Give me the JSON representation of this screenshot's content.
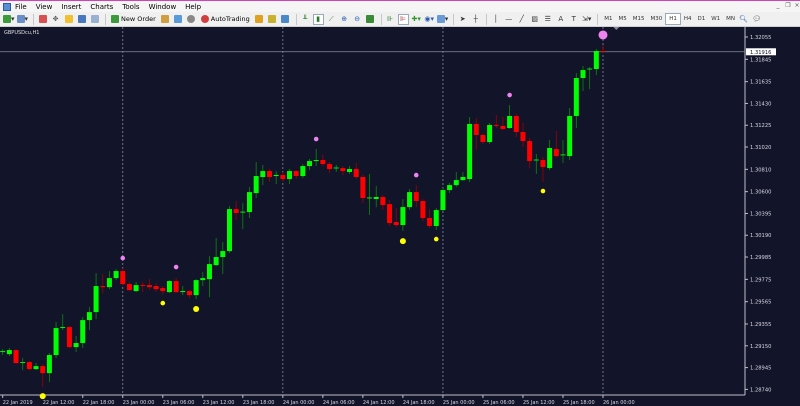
{
  "menu": {
    "items": [
      "File",
      "View",
      "Insert",
      "Charts",
      "Tools",
      "Window",
      "Help"
    ]
  },
  "window_controls": [
    "minimize",
    "restore",
    "close"
  ],
  "toolbar": {
    "new_order_label": "New Order",
    "autotrading_label": "AutoTrading",
    "timeframes": [
      "M1",
      "M5",
      "M15",
      "M30",
      "H1",
      "H4",
      "D1",
      "W1",
      "MN"
    ],
    "active_timeframe": "H1"
  },
  "chart": {
    "title": "GBPUSDcu,H1",
    "current_price": "1.31916",
    "colors": {
      "background": "#12142a",
      "bull": "#00ff00",
      "bear": "#ff0000",
      "grid": "#8a8a9a",
      "pink_marker": "#ee82ee",
      "yellow_marker": "#ffff00"
    }
  },
  "chart_data": {
    "type": "candlestick",
    "symbol": "GBPUSDcu",
    "timeframe": "H1",
    "price_ticks": [
      "1.32055",
      "1.31845",
      "1.31635",
      "1.31430",
      "1.31225",
      "1.31020",
      "1.30810",
      "1.30600",
      "1.30395",
      "1.30190",
      "1.29985",
      "1.29775",
      "1.29565",
      "1.29355",
      "1.29150",
      "1.28945",
      "1.28740",
      "1.28530"
    ],
    "time_ticks": [
      "22 Jan 2019",
      "22 Jan 12:00",
      "22 Jan 18:00",
      "23 Jan 00:00",
      "23 Jan 06:00",
      "23 Jan 12:00",
      "23 Jan 18:00",
      "24 Jan 00:00",
      "24 Jan 06:00",
      "24 Jan 12:00",
      "24 Jan 18:00",
      "25 Jan 00:00",
      "25 Jan 06:00",
      "25 Jan 12:00",
      "25 Jan 18:00",
      "26 Jan 00:00"
    ],
    "day_separators": [
      "23 Jan 00:00",
      "24 Jan 00:00",
      "25 Jan 00:00",
      "26 Jan 00:00"
    ],
    "ohlc": [
      [
        1.29091,
        1.29119,
        1.29063,
        1.291
      ],
      [
        1.29072,
        1.29129,
        1.29054,
        1.2911
      ],
      [
        1.2911,
        1.29119,
        1.28978,
        1.28988
      ],
      [
        1.28997,
        1.29035,
        1.28921,
        1.28997
      ],
      [
        1.28997,
        1.29006,
        1.28921,
        1.28931
      ],
      [
        1.28931,
        1.28988,
        1.28921,
        1.28959
      ],
      [
        1.28959,
        1.28978,
        1.28761,
        1.28893
      ],
      [
        1.28893,
        1.29082,
        1.28808,
        1.29063
      ],
      [
        1.29063,
        1.29373,
        1.29035,
        1.29317
      ],
      [
        1.29317,
        1.29448,
        1.29298,
        1.29326
      ],
      [
        1.29326,
        1.29336,
        1.29129,
        1.29138
      ],
      [
        1.29138,
        1.29242,
        1.29091,
        1.29176
      ],
      [
        1.29176,
        1.2942,
        1.29129,
        1.29392
      ],
      [
        1.29392,
        1.29514,
        1.29298,
        1.29467
      ],
      [
        1.29467,
        1.29834,
        1.29401,
        1.29712
      ],
      [
        1.29712,
        1.29824,
        1.29646,
        1.29702
      ],
      [
        1.29702,
        1.29853,
        1.29683,
        1.29787
      ],
      [
        1.29787,
        1.29872,
        1.29768,
        1.29853
      ],
      [
        1.29853,
        1.29881,
        1.29721,
        1.29731
      ],
      [
        1.29731,
        1.29749,
        1.29665,
        1.29674
      ],
      [
        1.29665,
        1.29749,
        1.29655,
        1.29721
      ],
      [
        1.29721,
        1.29749,
        1.29655,
        1.29717
      ],
      [
        1.29721,
        1.29777,
        1.29674,
        1.29702
      ],
      [
        1.29712,
        1.2974,
        1.29655,
        1.29683
      ],
      [
        1.29693,
        1.29712,
        1.29636,
        1.29665
      ],
      [
        1.29655,
        1.29768,
        1.29646,
        1.29759
      ],
      [
        1.29759,
        1.29787,
        1.29646,
        1.29655
      ],
      [
        1.29655,
        1.29712,
        1.29627,
        1.29665
      ],
      [
        1.29665,
        1.29674,
        1.29599,
        1.29627
      ],
      [
        1.29627,
        1.29777,
        1.29589,
        1.29768
      ],
      [
        1.29768,
        1.29843,
        1.29712,
        1.29787
      ],
      [
        1.29777,
        1.29994,
        1.29608,
        1.29919
      ],
      [
        1.29909,
        1.30164,
        1.299,
        1.29985
      ],
      [
        1.29985,
        1.30126,
        1.29825,
        1.30041
      ],
      [
        1.30041,
        1.30465,
        1.30023,
        1.30436
      ],
      [
        1.30436,
        1.30512,
        1.30333,
        1.30399
      ],
      [
        1.30408,
        1.30493,
        1.30248,
        1.30412
      ],
      [
        1.30408,
        1.30643,
        1.30352,
        1.30596
      ],
      [
        1.30587,
        1.30879,
        1.3054,
        1.30747
      ],
      [
        1.30738,
        1.30851,
        1.30662,
        1.30794
      ],
      [
        1.30794,
        1.30813,
        1.30691,
        1.30738
      ],
      [
        1.30747,
        1.30794,
        1.30672,
        1.30757
      ],
      [
        1.30757,
        1.30785,
        1.307,
        1.30719
      ],
      [
        1.30719,
        1.30813,
        1.30672,
        1.30794
      ],
      [
        1.30794,
        1.30803,
        1.30719,
        1.30747
      ],
      [
        1.30747,
        1.3086,
        1.30728,
        1.30841
      ],
      [
        1.30841,
        1.30907,
        1.30803,
        1.30888
      ],
      [
        1.30888,
        1.31001,
        1.30841,
        1.30898
      ],
      [
        1.30898,
        1.30945,
        1.30841,
        1.3086
      ],
      [
        1.3086,
        1.30879,
        1.30775,
        1.30813
      ],
      [
        1.30822,
        1.30851,
        1.30785,
        1.30827
      ],
      [
        1.30822,
        1.30841,
        1.30757,
        1.30794
      ],
      [
        1.30785,
        1.30841,
        1.30766,
        1.30813
      ],
      [
        1.30813,
        1.3087,
        1.30719,
        1.30738
      ],
      [
        1.30738,
        1.30757,
        1.30493,
        1.3054
      ],
      [
        1.3054,
        1.30766,
        1.3038,
        1.30545
      ],
      [
        1.30531,
        1.30653,
        1.30455,
        1.3055
      ],
      [
        1.3055,
        1.30568,
        1.30427,
        1.30474
      ],
      [
        1.30483,
        1.30521,
        1.30277,
        1.30305
      ],
      [
        1.30314,
        1.30446,
        1.30267,
        1.30286
      ],
      [
        1.30286,
        1.30531,
        1.3023,
        1.30455
      ],
      [
        1.30455,
        1.30625,
        1.30427,
        1.30596
      ],
      [
        1.30596,
        1.30662,
        1.30455,
        1.30512
      ],
      [
        1.30512,
        1.30531,
        1.30324,
        1.30352
      ],
      [
        1.30352,
        1.30436,
        1.30258,
        1.30277
      ],
      [
        1.30277,
        1.30446,
        1.30239,
        1.30427
      ],
      [
        1.30427,
        1.30634,
        1.30418,
        1.30615
      ],
      [
        1.30615,
        1.30681,
        1.30587,
        1.30662
      ],
      [
        1.30662,
        1.30785,
        1.30643,
        1.30709
      ],
      [
        1.30709,
        1.30785,
        1.307,
        1.30738
      ],
      [
        1.30719,
        1.31302,
        1.30691,
        1.31237
      ],
      [
        1.31237,
        1.31293,
        1.30992,
        1.31133
      ],
      [
        1.31133,
        1.31152,
        1.31048,
        1.31067
      ],
      [
        1.31067,
        1.31246,
        1.31048,
        1.31227
      ],
      [
        1.31227,
        1.31321,
        1.31199,
        1.31223
      ],
      [
        1.31218,
        1.31302,
        1.3118,
        1.3119
      ],
      [
        1.31199,
        1.31415,
        1.3119,
        1.31312
      ],
      [
        1.31312,
        1.3133,
        1.31114,
        1.31161
      ],
      [
        1.31161,
        1.31246,
        1.3102,
        1.31076
      ],
      [
        1.31076,
        1.31105,
        1.30822,
        1.30888
      ],
      [
        1.30898,
        1.30954,
        1.30766,
        1.30902
      ],
      [
        1.30898,
        1.30926,
        1.30691,
        1.30832
      ],
      [
        1.30822,
        1.31086,
        1.30803,
        1.31011
      ],
      [
        1.31001,
        1.31171,
        1.30917,
        1.30935
      ],
      [
        1.30945,
        1.31086,
        1.3087,
        1.3095
      ],
      [
        1.30935,
        1.31387,
        1.30898,
        1.31312
      ],
      [
        1.31312,
        1.31716,
        1.31199,
        1.31669
      ],
      [
        1.31669,
        1.31782,
        1.31547,
        1.31744
      ],
      [
        1.31754,
        1.31772,
        1.31566,
        1.31758
      ],
      [
        1.31754,
        1.31942,
        1.31697,
        1.31923
      ],
      [
        1.31923,
        1.3198,
        1.31904,
        1.31916
      ]
    ],
    "markers": [
      {
        "bar": 18,
        "price": 1.29975,
        "color": "pink"
      },
      {
        "bar": 26,
        "price": 1.29891,
        "color": "pink"
      },
      {
        "bar": 47,
        "price": 1.31095,
        "color": "pink"
      },
      {
        "bar": 62,
        "price": 1.30756,
        "color": "pink"
      },
      {
        "bar": 76,
        "price": 1.31509,
        "color": "pink"
      },
      {
        "bar": 90,
        "price": 1.32074,
        "color": "pink",
        "large": true
      },
      {
        "bar": 6,
        "price": 1.28677,
        "color": "yellow"
      },
      {
        "bar": 24,
        "price": 1.29552,
        "color": "yellow"
      },
      {
        "bar": 29,
        "price": 1.29496,
        "color": "yellow"
      },
      {
        "bar": 60,
        "price": 1.30135,
        "color": "yellow"
      },
      {
        "bar": 65,
        "price": 1.30154,
        "color": "yellow"
      },
      {
        "bar": 81,
        "price": 1.30606,
        "color": "yellow"
      }
    ]
  }
}
